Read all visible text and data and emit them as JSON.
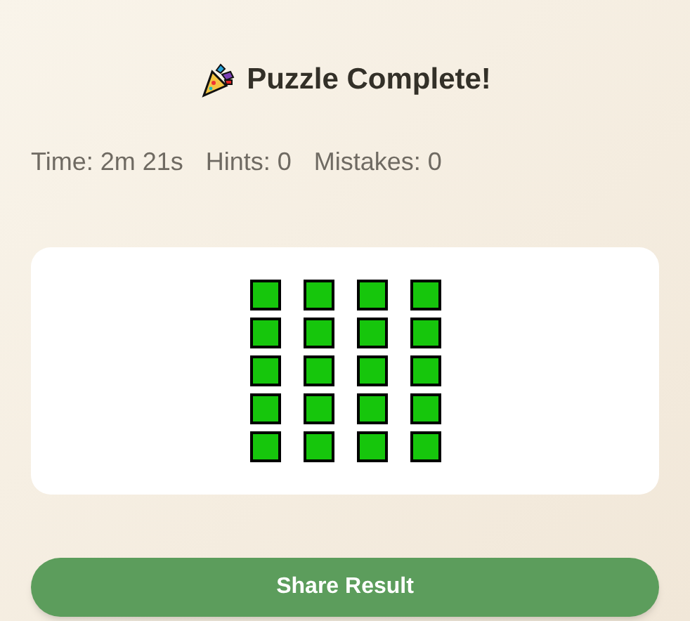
{
  "title": "Puzzle Complete!",
  "stats": [
    "Time: 2m 21s",
    "Hints: 0",
    "Mistakes: 0"
  ],
  "result_grid": [
    {
      "cells": [
        {
          "color": "#16c60c"
        },
        {
          "color": "#16c60c"
        },
        {
          "color": "#16c60c"
        },
        {
          "color": "#16c60c"
        }
      ]
    },
    {
      "cells": [
        {
          "color": "#16c60c"
        },
        {
          "color": "#16c60c"
        },
        {
          "color": "#16c60c"
        },
        {
          "color": "#16c60c"
        }
      ]
    },
    {
      "cells": [
        {
          "color": "#16c60c"
        },
        {
          "color": "#16c60c"
        },
        {
          "color": "#16c60c"
        },
        {
          "color": "#16c60c"
        }
      ]
    },
    {
      "cells": [
        {
          "color": "#16c60c"
        },
        {
          "color": "#16c60c"
        },
        {
          "color": "#16c60c"
        },
        {
          "color": "#16c60c"
        }
      ]
    },
    {
      "cells": [
        {
          "color": "#16c60c"
        },
        {
          "color": "#16c60c"
        },
        {
          "color": "#16c60c"
        },
        {
          "color": "#16c60c"
        }
      ]
    }
  ],
  "share_button": "Share Result"
}
